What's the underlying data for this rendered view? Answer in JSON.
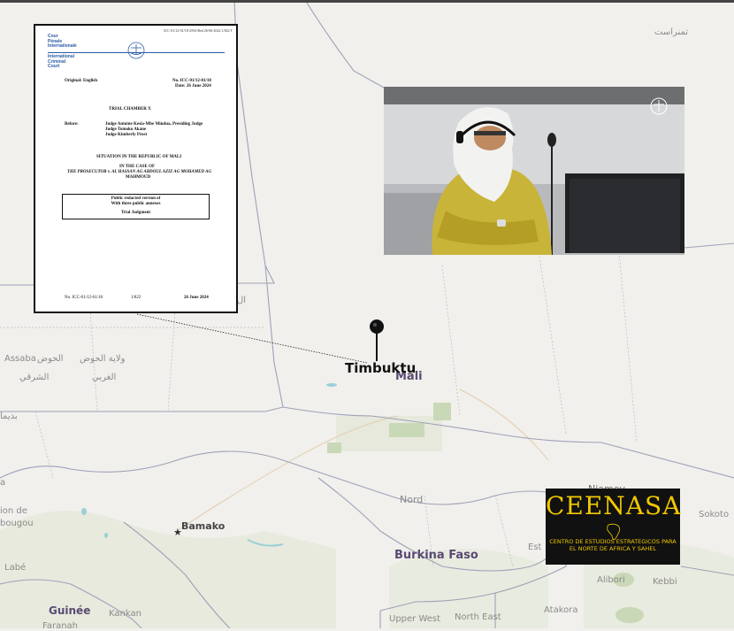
{
  "map": {
    "labels": {
      "tamanrasset": "تمنراست",
      "assaba": "Assaba",
      "assaba_ar": "الحوض",
      "hodh_w": "ولاية الحوض",
      "hodh_east": "الشرقي",
      "hodh_west": "الغربي",
      "mali": "Mali",
      "nord": "Nord",
      "bamako": "Bamako",
      "burkina": "Burkina Faso",
      "niamey": "Niamey",
      "sokoto": "Sokoto",
      "est": "Est",
      "alibori": "Alibori",
      "kebbi": "Kebbi",
      "atakora": "Atakora",
      "upperwest": "Upper West",
      "northeast": "North East",
      "kankan": "Kankan",
      "guinee": "Guinée",
      "labe": "Labé",
      "farana": "Faranah",
      "on_de": "ion de",
      "bougou": "bougou",
      "bidima": "بديما",
      "a_left": "a",
      "l_cut": "ال"
    },
    "marker": {
      "label": "Timbuktu",
      "icon": "map-pin-icon"
    }
  },
  "document": {
    "header_id": "ICC-01/12-01/18-2594-Red 26-06-2024 1/822 T",
    "court_fr": [
      "Cour",
      "Pénale",
      "Internationale"
    ],
    "court_en": [
      "International",
      "Criminal",
      "Court"
    ],
    "original": "Original: English",
    "case_no": "No. ICC-01/12-01/18",
    "date": "Date: 26 June 2024",
    "chamber": "TRIAL CHAMBER X",
    "before": "Before:",
    "judges": [
      "Judge Antoine Kesia-Mbe Mindua, Presiding Judge",
      "Judge Tomoko Akane",
      "Judge Kimberly Prost"
    ],
    "situation": "SITUATION IN THE REPUBLIC OF MALI",
    "case_line1": "IN THE CASE OF",
    "case_line2": "THE PROSECUTOR v. AL HASSAN AG ABDOUL AZIZ AG MOHAMED AG",
    "case_line3": "MAHMOUD",
    "box_line1": "Public redacted version of",
    "box_line2": "With three public annexes",
    "box_title": "Trial Judgment",
    "footer_no": "No. ICC-01/12-01/18",
    "footer_page": "1/822",
    "footer_date": "26 June 2024"
  },
  "logo": {
    "name": "CEENASA",
    "subtitle1": "CENTRO DE ESTUDIOS ESTRATEGICOS PARA",
    "subtitle2": "EL NORTE DE AFRICA Y SAHEL"
  },
  "colors": {
    "map_bg": "#f1f0ec",
    "border": "#9fa1b8",
    "water": "#9ccfd8",
    "green": "#c9d8b6",
    "logo_bg": "#111111",
    "logo_text": "#f0c800"
  }
}
